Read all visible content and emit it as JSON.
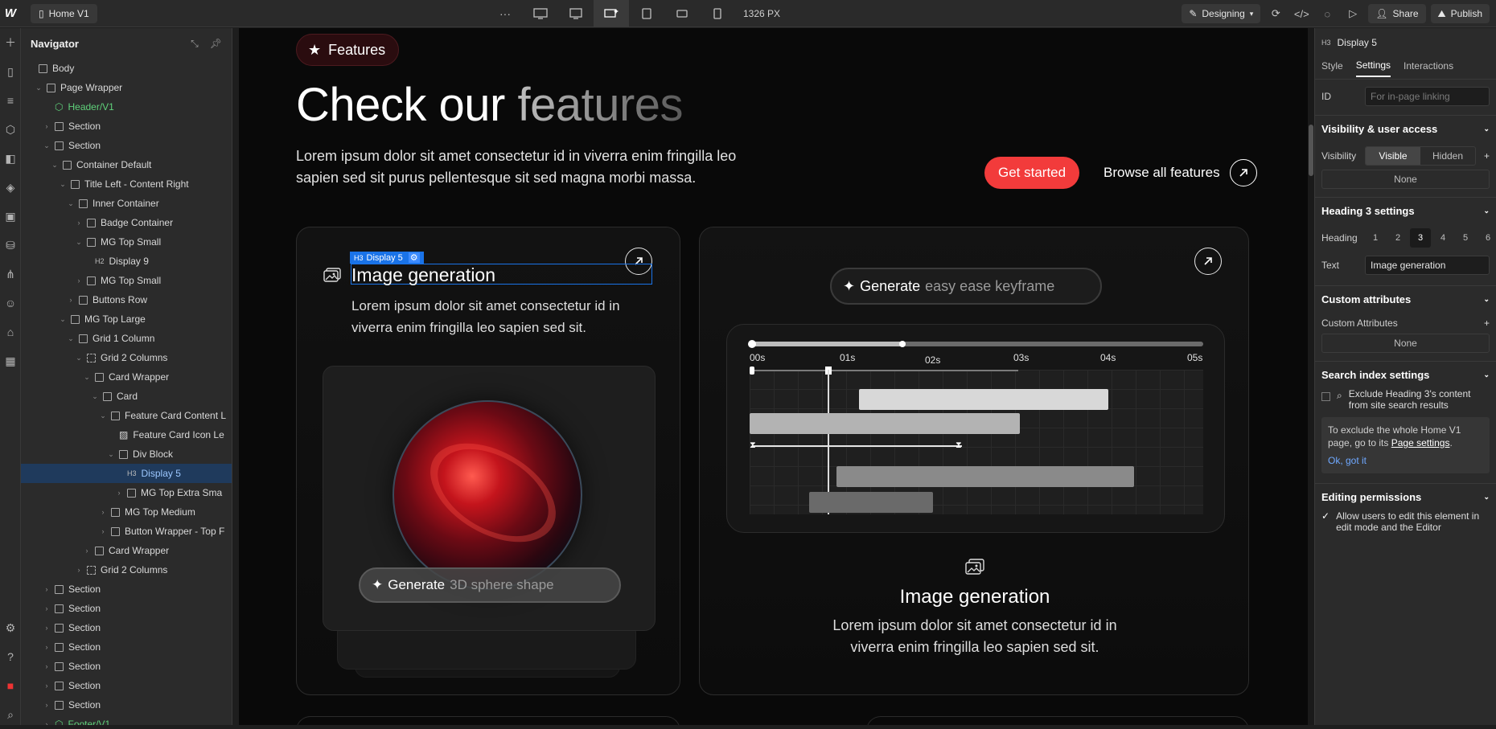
{
  "topbar": {
    "logo": "W",
    "page_name": "Home V1",
    "more": "···",
    "width_label": "1326 PX",
    "mode": "Designing",
    "share": "Share",
    "publish": "Publish"
  },
  "navigator": {
    "title": "Navigator",
    "items": [
      {
        "label": "Body",
        "depth": 0,
        "caret": "",
        "kind": "box"
      },
      {
        "label": "Page Wrapper",
        "depth": 1,
        "caret": "v",
        "kind": "box"
      },
      {
        "label": "Header/V1",
        "depth": 2,
        "caret": "",
        "kind": "comp"
      },
      {
        "label": "Section",
        "depth": 2,
        "caret": ">",
        "kind": "box"
      },
      {
        "label": "Section",
        "depth": 2,
        "caret": "v",
        "kind": "box"
      },
      {
        "label": "Container Default",
        "depth": 3,
        "caret": "v",
        "kind": "box"
      },
      {
        "label": "Title Left - Content Right",
        "depth": 4,
        "caret": "v",
        "kind": "box"
      },
      {
        "label": "Inner Container",
        "depth": 5,
        "caret": "v",
        "kind": "box"
      },
      {
        "label": "Badge Container",
        "depth": 6,
        "caret": ">",
        "kind": "box"
      },
      {
        "label": "MG Top Small",
        "depth": 6,
        "caret": "v",
        "kind": "box"
      },
      {
        "label": "Display 9",
        "depth": 7,
        "caret": "",
        "kind": "h2"
      },
      {
        "label": "MG Top Small",
        "depth": 6,
        "caret": ">",
        "kind": "box"
      },
      {
        "label": "Buttons Row",
        "depth": 5,
        "caret": ">",
        "kind": "box"
      },
      {
        "label": "MG Top Large",
        "depth": 4,
        "caret": "v",
        "kind": "box"
      },
      {
        "label": "Grid 1 Column",
        "depth": 5,
        "caret": "v",
        "kind": "box"
      },
      {
        "label": "Grid 2 Columns",
        "depth": 6,
        "caret": "v",
        "kind": "grid"
      },
      {
        "label": "Card Wrapper",
        "depth": 7,
        "caret": "v",
        "kind": "box"
      },
      {
        "label": "Card",
        "depth": 8,
        "caret": "v",
        "kind": "box"
      },
      {
        "label": "Feature Card Content L",
        "depth": 9,
        "caret": "v",
        "kind": "box"
      },
      {
        "label": "Feature Card Icon Le",
        "depth": 10,
        "caret": "",
        "kind": "img"
      },
      {
        "label": "Div Block",
        "depth": 10,
        "caret": "v",
        "kind": "box"
      },
      {
        "label": "Display 5",
        "depth": 11,
        "caret": "",
        "kind": "h3",
        "selected": true
      },
      {
        "label": "MG Top Extra Sma",
        "depth": 11,
        "caret": ">",
        "kind": "box"
      },
      {
        "label": "MG Top Medium",
        "depth": 9,
        "caret": ">",
        "kind": "box"
      },
      {
        "label": "Button Wrapper - Top F",
        "depth": 9,
        "caret": ">",
        "kind": "box"
      },
      {
        "label": "Card Wrapper",
        "depth": 7,
        "caret": ">",
        "kind": "box"
      },
      {
        "label": "Grid 2 Columns",
        "depth": 6,
        "caret": ">",
        "kind": "grid"
      },
      {
        "label": "Section",
        "depth": 2,
        "caret": ">",
        "kind": "box"
      },
      {
        "label": "Section",
        "depth": 2,
        "caret": ">",
        "kind": "box"
      },
      {
        "label": "Section",
        "depth": 2,
        "caret": ">",
        "kind": "box"
      },
      {
        "label": "Section",
        "depth": 2,
        "caret": ">",
        "kind": "box"
      },
      {
        "label": "Section",
        "depth": 2,
        "caret": ">",
        "kind": "box"
      },
      {
        "label": "Section",
        "depth": 2,
        "caret": ">",
        "kind": "box"
      },
      {
        "label": "Section",
        "depth": 2,
        "caret": ">",
        "kind": "box"
      },
      {
        "label": "Footer/V1",
        "depth": 2,
        "caret": ">",
        "kind": "comp"
      }
    ]
  },
  "canvas": {
    "badge": "Features",
    "title_main": "Check our ",
    "title_fade": "features",
    "description": "Lorem ipsum dolor sit amet consectetur id in viverra enim fringilla leo sapien sed sit purus pellentesque sit sed magna morbi massa.",
    "cta_primary": "Get started",
    "cta_secondary": "Browse all features",
    "card1": {
      "selection_tag": "Display 5",
      "selection_prefix": "H3",
      "title": "Image generation",
      "description": "Lorem ipsum dolor sit amet consectetur id in viverra enim fringilla leo sapien sed sit.",
      "prompt_bold": "Generate",
      "prompt_muted": "3D sphere shape"
    },
    "card2": {
      "prompt_bold": "Generate",
      "prompt_muted": "easy ease keyframe",
      "ticks": [
        "00s",
        "01s",
        "02s",
        "03s",
        "04s",
        "05s"
      ],
      "title": "Image generation",
      "description": "Lorem ipsum dolor sit amet consectetur id in viverra enim fringilla leo sapien sed sit."
    }
  },
  "panel": {
    "element": "Display 5",
    "element_prefix": "H3",
    "tabs": [
      "Style",
      "Settings",
      "Interactions"
    ],
    "active_tab": "Settings",
    "id_label": "ID",
    "id_placeholder": "For in-page linking",
    "visibility_section": "Visibility & user access",
    "visibility_label": "Visibility",
    "visible": "Visible",
    "hidden": "Hidden",
    "none1": "None",
    "heading_section": "Heading 3 settings",
    "heading_label": "Heading",
    "heading_levels": [
      "1",
      "2",
      "3",
      "4",
      "5",
      "6"
    ],
    "text_label": "Text",
    "text_value": "Image generation",
    "custom_section": "Custom attributes",
    "custom_label": "Custom Attributes",
    "none2": "None",
    "search_section": "Search index settings",
    "exclude_text": "Exclude Heading 3's content from site search results",
    "note_pre": "To exclude the whole Home V1 page, go to its",
    "note_link": "Page settings",
    "note_ok": "Ok, got it",
    "perm_section": "Editing permissions",
    "perm_text": "Allow users to edit this element in edit mode and the Editor"
  }
}
